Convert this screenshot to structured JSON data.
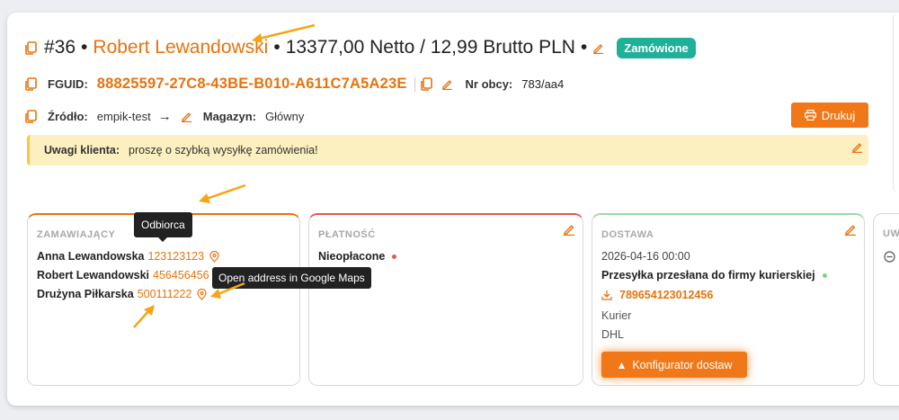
{
  "order": {
    "number": "#36",
    "customer_name": "Robert Lewandowski",
    "price_text": "13377,00 Netto / 12,99 Brutto PLN",
    "status_badge": "Zamówione"
  },
  "ids": {
    "fguid_label": "FGUID:",
    "fguid_value": "88825597-27C8-43BE-B010-A611C7A5A23E",
    "foreign_no_label": "Nr obcy:",
    "foreign_no_value": "783/aa4"
  },
  "source": {
    "source_label": "Źródło:",
    "source_value": "empik-test",
    "warehouse_label": "Magazyn:",
    "warehouse_value": "Główny"
  },
  "print_button": "Drukuj",
  "notice": {
    "label": "Uwagi klienta:",
    "text": "proszę o szybką wysyłkę zamówienia!"
  },
  "panels": {
    "ordering": {
      "title": "ZAMAWIAJĄCY",
      "rows": [
        {
          "name": "Anna Lewandowska",
          "phone": "123123123"
        },
        {
          "name": "Robert Lewandowski",
          "phone": "456456456"
        },
        {
          "name": "Drużyna Piłkarska",
          "phone": "500111222"
        }
      ]
    },
    "payment": {
      "title": "PŁATNOŚĆ",
      "status": "Nieopłacone"
    },
    "delivery": {
      "title": "DOSTAWA",
      "date": "2026-04-16 00:00",
      "status": "Przesyłka przesłana do firmy kurierskiej",
      "tracking": "789654123012456",
      "method": "Kurier",
      "carrier": "DHL",
      "configurator_button": "Konfigurator dostaw"
    },
    "notes": {
      "title": "UW"
    }
  },
  "tooltips": {
    "recipient": "Odbiorca",
    "maps": "Open address in Google Maps"
  },
  "colors": {
    "accent": "#e8730c",
    "badge": "#1fb09a",
    "ordering_border": "#e8730c",
    "payment_border": "#e05a5a",
    "delivery_border": "#9ed99e"
  }
}
